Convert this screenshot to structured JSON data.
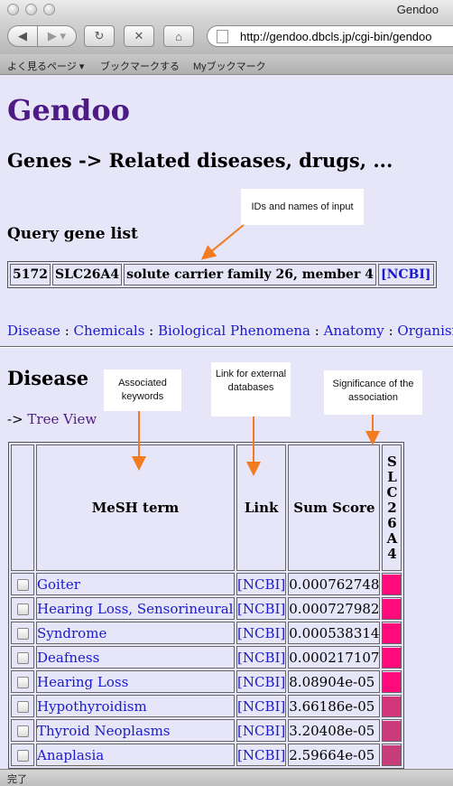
{
  "window": {
    "title": "Gendoo"
  },
  "toolbar": {
    "url": "http://gendoo.dbcls.jp/cgi-bin/gendoo"
  },
  "bookmarks": [
    "よく見るページ ▾",
    "ブックマークする",
    "Myブックマーク"
  ],
  "page": {
    "site_title": "Gendoo",
    "heading": "Genes -> Related diseases, drugs, ...",
    "query_heading": "Query gene list",
    "query_row": {
      "id": "5172",
      "symbol": "SLC26A4",
      "name": "solute carrier family 26, member 4",
      "link": "[NCBI]"
    },
    "nav_links": [
      "Disease",
      "Chemicals",
      "Biological Phenomena",
      "Anatomy",
      "Organisms"
    ],
    "nav_sep": " : ",
    "section_title": "Disease",
    "tree_prefix": "->",
    "tree_view": "Tree View",
    "table": {
      "headers": {
        "term": "MeSH term",
        "link": "Link",
        "score": "Sum Score",
        "gene": "SLC26A4"
      },
      "rows": [
        {
          "term": "Goiter",
          "link": "[NCBI]",
          "score": "0.000762748",
          "color": "#ff0a7a"
        },
        {
          "term": "Hearing Loss, Sensorineural",
          "link": "[NCBI]",
          "score": "0.000727982",
          "color": "#ff0a7a"
        },
        {
          "term": "Syndrome",
          "link": "[NCBI]",
          "score": "0.000538314",
          "color": "#ff0a7a"
        },
        {
          "term": "Deafness",
          "link": "[NCBI]",
          "score": "0.000217107",
          "color": "#ff0a7a"
        },
        {
          "term": "Hearing Loss",
          "link": "[NCBI]",
          "score": "8.08904e-05",
          "color": "#ff0a7a"
        },
        {
          "term": "Hypothyroidism",
          "link": "[NCBI]",
          "score": "3.66186e-05",
          "color": "#d2357a"
        },
        {
          "term": "Thyroid Neoplasms",
          "link": "[NCBI]",
          "score": "3.20408e-05",
          "color": "#cb3a7a"
        },
        {
          "term": "Anaplasia",
          "link": "[NCBI]",
          "score": "2.59664e-05",
          "color": "#c63d7a"
        }
      ]
    }
  },
  "annotations": {
    "input": "IDs and names of input",
    "keywords": "Associated keywords",
    "external": "Link for external databases",
    "significance": "Significance of the association"
  },
  "status": {
    "text": "完了"
  },
  "colors": {
    "background": "#e6e6f8",
    "site_title": "#4e1a86",
    "link": "#1a1acc",
    "arrow": "#f27a1f"
  }
}
